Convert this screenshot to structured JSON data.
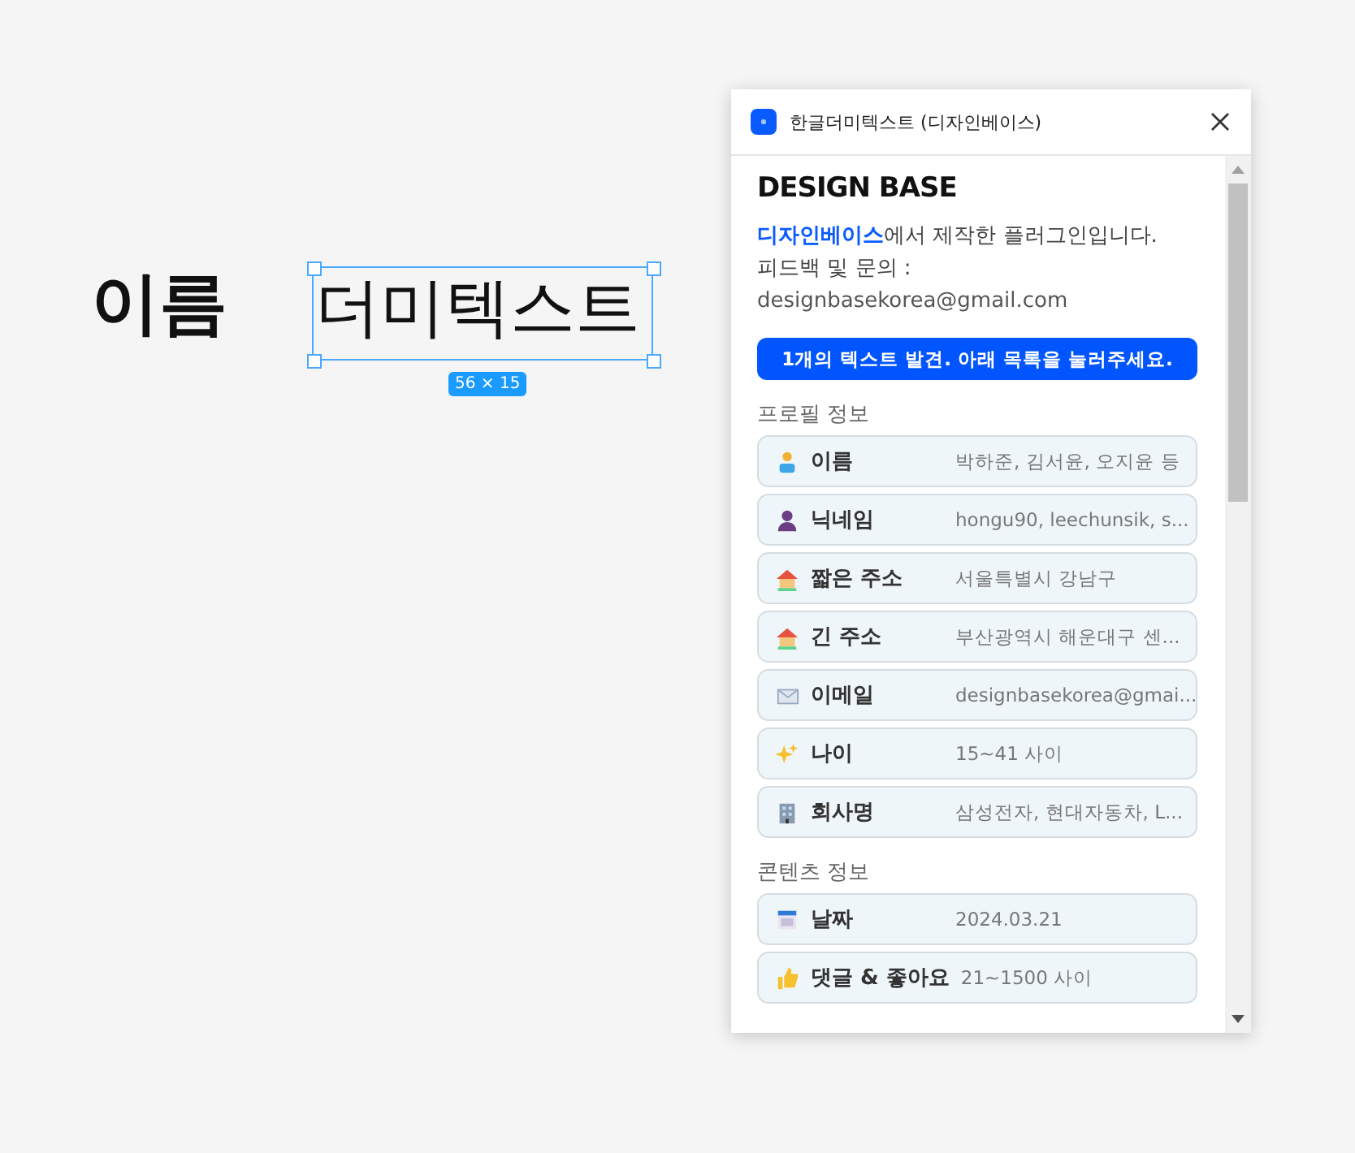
{
  "canvas": {
    "label": "이름",
    "selected_text": "더미텍스트",
    "size_badge": "56 × 15"
  },
  "plugin": {
    "title": "한글더미텍스트 (디자인베이스)",
    "logo": "DESIGN BASE",
    "intro": "디자인베이스",
    "intro_rest": "에서 제작한 플러그인입니다.",
    "feedback": "피드백 및 문의 :",
    "email": "designbasekorea@gmail.com",
    "found_button": "1개의 텍스트 발견. 아래 목록을 눌러주세요.",
    "sections": [
      {
        "title": "프로필 정보",
        "items": [
          {
            "label": "이름",
            "example": "박하준, 김서윤, 오지윤 등"
          },
          {
            "label": "닉네임",
            "example": "hongu90, leechunsik, s..."
          },
          {
            "label": "짧은 주소",
            "example": "서울특별시 강남구"
          },
          {
            "label": "긴 주소",
            "example": "부산광역시 해운대구 센..."
          },
          {
            "label": "이메일",
            "example": "designbasekorea@gmai..."
          },
          {
            "label": "나이",
            "example": "15~41 사이"
          },
          {
            "label": "회사명",
            "example": "삼성전자, 현대자동차, L..."
          }
        ]
      },
      {
        "title": "콘텐츠 정보",
        "items": [
          {
            "label": "날짜",
            "example": "2024.03.21"
          },
          {
            "label": "댓글 & 좋아요",
            "example": "21~1500 사이"
          }
        ]
      }
    ]
  }
}
